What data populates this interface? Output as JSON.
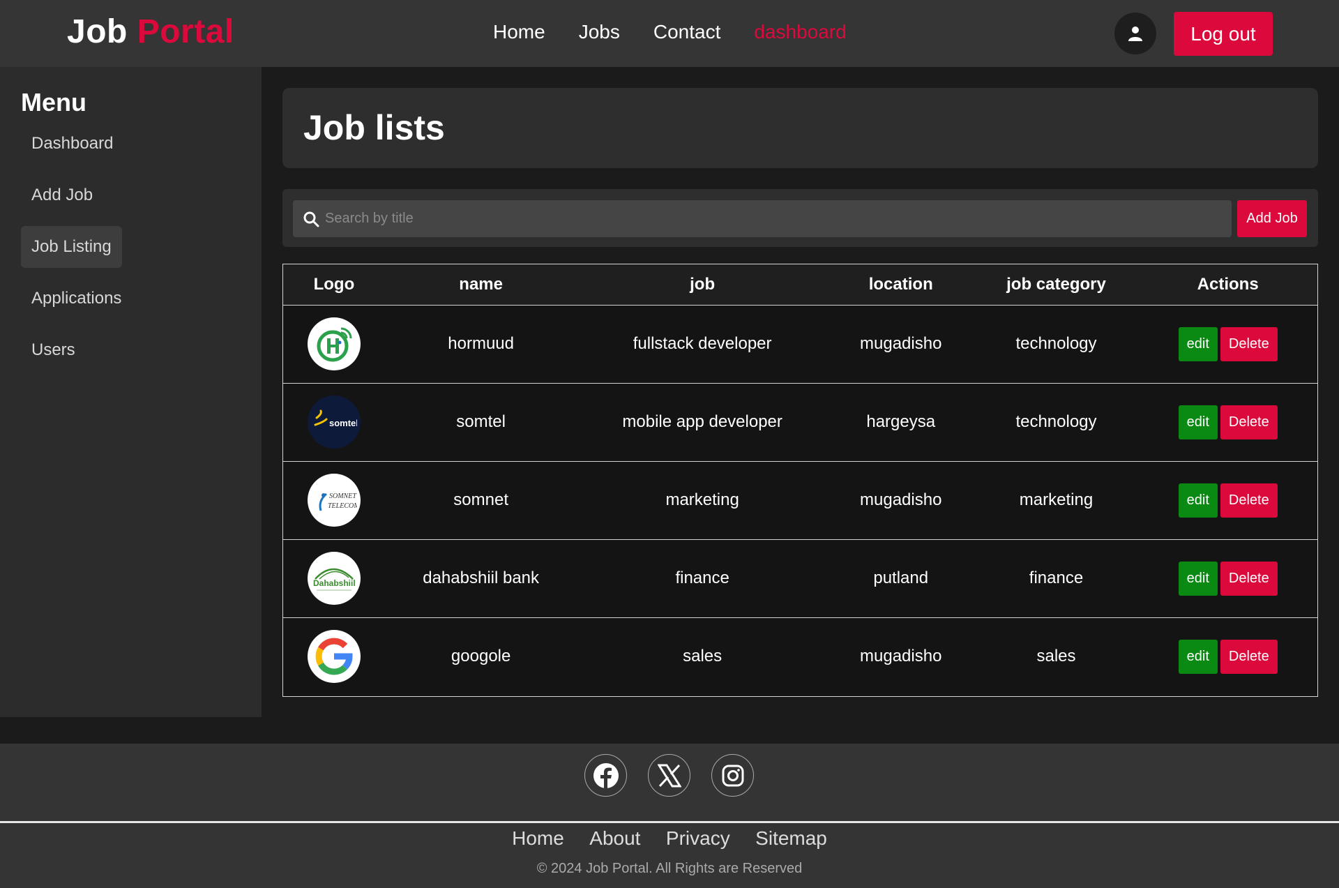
{
  "header": {
    "logo_part1": "Job",
    "logo_part2": "Portal",
    "nav": [
      "Home",
      "Jobs",
      "Contact",
      "dashboard"
    ],
    "logout_label": "Log out"
  },
  "sidebar": {
    "title": "Menu",
    "items": [
      "Dashboard",
      "Add Job",
      "Job Listing",
      "Applications",
      "Users"
    ],
    "active": "Job Listing"
  },
  "main": {
    "title": "Job lists",
    "search_placeholder": "Search by title",
    "add_job_label": "Add Job",
    "columns": [
      "Logo",
      "name",
      "job",
      "location",
      "job category",
      "Actions"
    ],
    "edit_label": "edit",
    "delete_label": "Delete",
    "rows": [
      {
        "logo": "hormuud-logo",
        "name": "hormuud",
        "job": "fullstack developer",
        "location": "mugadisho",
        "category": "technology"
      },
      {
        "logo": "somtel-logo",
        "name": "somtel",
        "job": "mobile app developer",
        "location": "hargeysa",
        "category": "technology"
      },
      {
        "logo": "somnet-logo",
        "name": "somnet",
        "job": "marketing",
        "location": "mugadisho",
        "category": "marketing"
      },
      {
        "logo": "dahabshiil-logo",
        "name": "dahabshiil bank",
        "job": "finance",
        "location": "putland",
        "category": "finance"
      },
      {
        "logo": "google-logo",
        "name": "googole",
        "job": "sales",
        "location": "mugadisho",
        "category": "sales"
      }
    ]
  },
  "footer": {
    "social": [
      "facebook-icon",
      "x-icon",
      "instagram-icon"
    ],
    "links": [
      "Home",
      "About",
      "Privacy",
      "Sitemap"
    ],
    "copyright": "© 2024 Job Portal. All Rights are Reserved"
  },
  "colors": {
    "accent": "#dc0a3c",
    "edit": "#0a8a12",
    "header_bg": "#353535",
    "sidebar_bg": "#2c2c2c",
    "page_bg": "#1b1b1b"
  }
}
